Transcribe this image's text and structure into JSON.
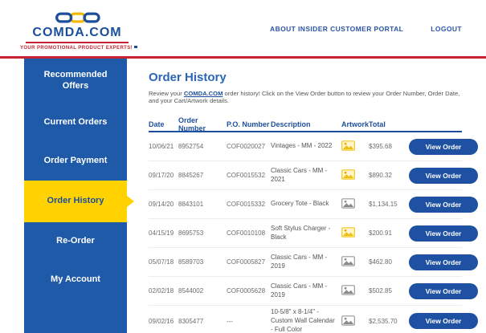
{
  "header": {
    "logo": {
      "brand": "COMDA.COM",
      "tagline": "YOUR PROMOTIONAL PRODUCT EXPERTS!",
      "flag_icon": "us-flag-icon",
      "chain_icon": "chain-links-icon"
    },
    "nav": {
      "about_label": "ABOUT INSIDER CUSTOMER PORTAL",
      "logout_label": "LOGOUT"
    }
  },
  "sidebar": {
    "items": [
      {
        "label": "Recommended Offers",
        "active": false
      },
      {
        "label": "Current Orders",
        "active": false
      },
      {
        "label": "Order Payment",
        "active": false
      },
      {
        "label": "Order History",
        "active": true
      },
      {
        "label": "Re-Order",
        "active": false
      },
      {
        "label": "My Account",
        "active": false
      }
    ]
  },
  "main": {
    "title": "Order History",
    "intro": {
      "prefix": "Review your ",
      "link": "COMDA.COM",
      "suffix": " order history! Click on the View Order button to review your Order Number, Order Date, and your Cart/Artwork details."
    },
    "table": {
      "columns": [
        "Date",
        "Order Number",
        "P.O. Number",
        "Description",
        "Artwork",
        "Total"
      ],
      "view_order_label": "View Order",
      "rows": [
        {
          "date": "10/06/21",
          "order_number": "8952754",
          "po_number": "COF0020027",
          "description": "Vintages - MM - 2022",
          "artwork_icon": "image-icon-yellow",
          "total": "$395.68"
        },
        {
          "date": "09/17/20",
          "order_number": "8845267",
          "po_number": "COF0015532",
          "description": "Classic Cars - MM - 2021",
          "artwork_icon": "image-icon-yellow",
          "total": "$890.32"
        },
        {
          "date": "09/14/20",
          "order_number": "8843101",
          "po_number": "COF0015332",
          "description": "Grocery Tote - Black",
          "artwork_icon": "image-icon-gray",
          "total": "$1,134.15"
        },
        {
          "date": "04/15/19",
          "order_number": "8695753",
          "po_number": "COF0010108",
          "description": "Soft Stylus Charger - Black",
          "artwork_icon": "image-icon-yellow",
          "total": "$200.91"
        },
        {
          "date": "05/07/18",
          "order_number": "8589703",
          "po_number": "COF0005827",
          "description": "Classic Cars - MM - 2019",
          "artwork_icon": "image-icon-gray",
          "total": "$462.80"
        },
        {
          "date": "02/02/18",
          "order_number": "8544002",
          "po_number": "COF0005628",
          "description": "Classic Cars - MM - 2019",
          "artwork_icon": "image-icon-gray",
          "total": "$502.85"
        },
        {
          "date": "09/02/16",
          "order_number": "8305477",
          "po_number": "---",
          "description": "10-5/8\" x 8-1/4\" - Custom Wall Calendar - Full Color",
          "artwork_icon": "image-icon-gray",
          "total": "$2,535.70"
        }
      ]
    }
  },
  "colors": {
    "brand_blue": "#1b4e9b",
    "sidebar_blue": "#1e5aa7",
    "accent_yellow": "#ffd200",
    "accent_red": "#c62333",
    "button_blue": "#1f51a3",
    "link_blue": "#1d4f9e"
  }
}
